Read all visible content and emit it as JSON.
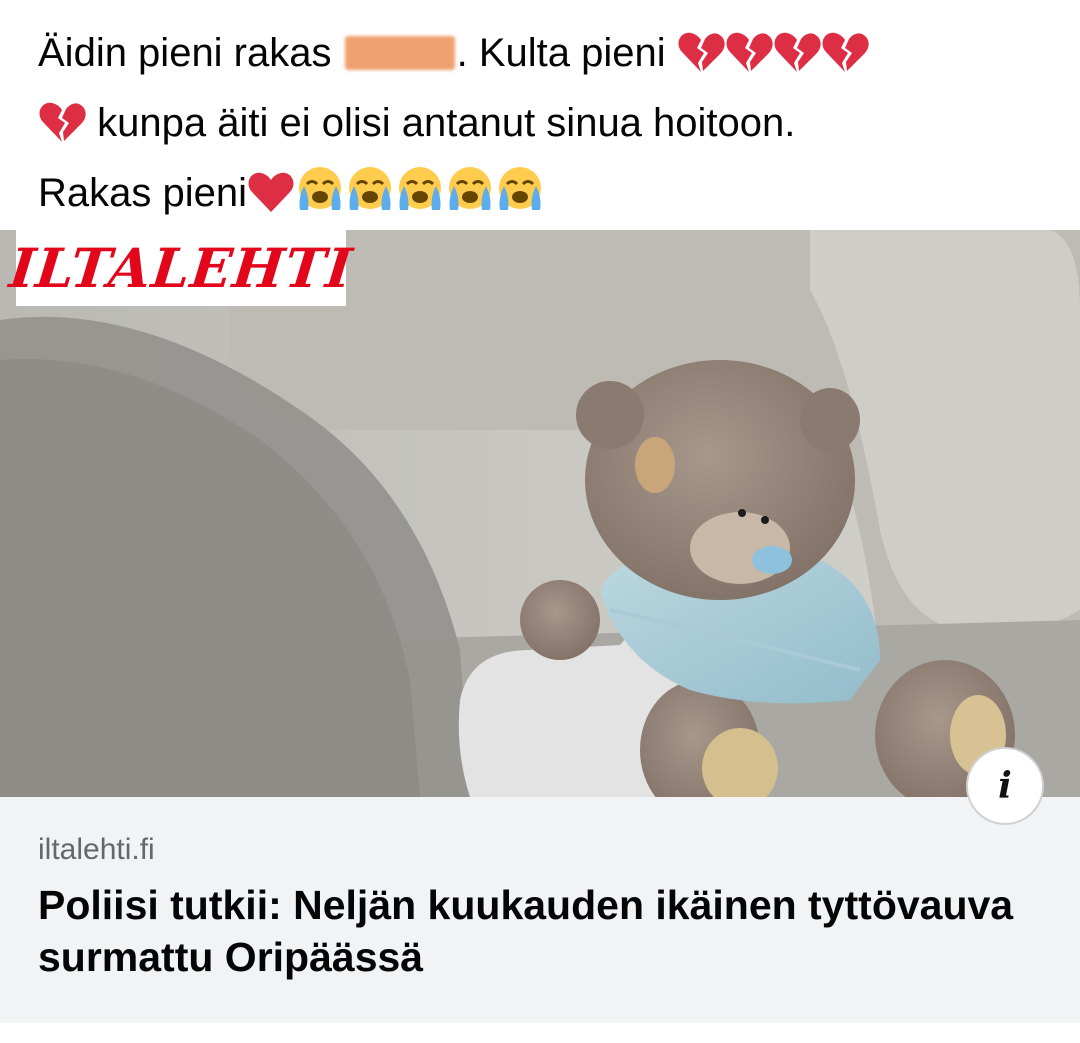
{
  "post": {
    "line1_prefix": "Äidin pieni rakas",
    "line1_suffix": ". Kulta pieni",
    "line2": "kunpa äiti ei olisi antanut sinua hoitoon.",
    "line3": "Rakas pieni",
    "redaction_color": "#f0a070",
    "emoji_line1": [
      "broken-heart-icon",
      "broken-heart-icon",
      "broken-heart-icon",
      "broken-heart-icon"
    ],
    "emoji_line2": [
      "broken-heart-icon"
    ],
    "emoji_line3": [
      "red-heart-icon",
      "crying-face-icon",
      "crying-face-icon",
      "crying-face-icon",
      "crying-face-icon",
      "crying-face-icon"
    ]
  },
  "link_card": {
    "brand_logo_text": "ILTALEHTI",
    "brand_color": "#e3061b",
    "info_icon": "info-icon",
    "domain": "iltalehti.fi",
    "headline": "Poliisi tutkii: Neljän kuukauden ikäinen tyttövauva surmattu Oripäässä"
  }
}
